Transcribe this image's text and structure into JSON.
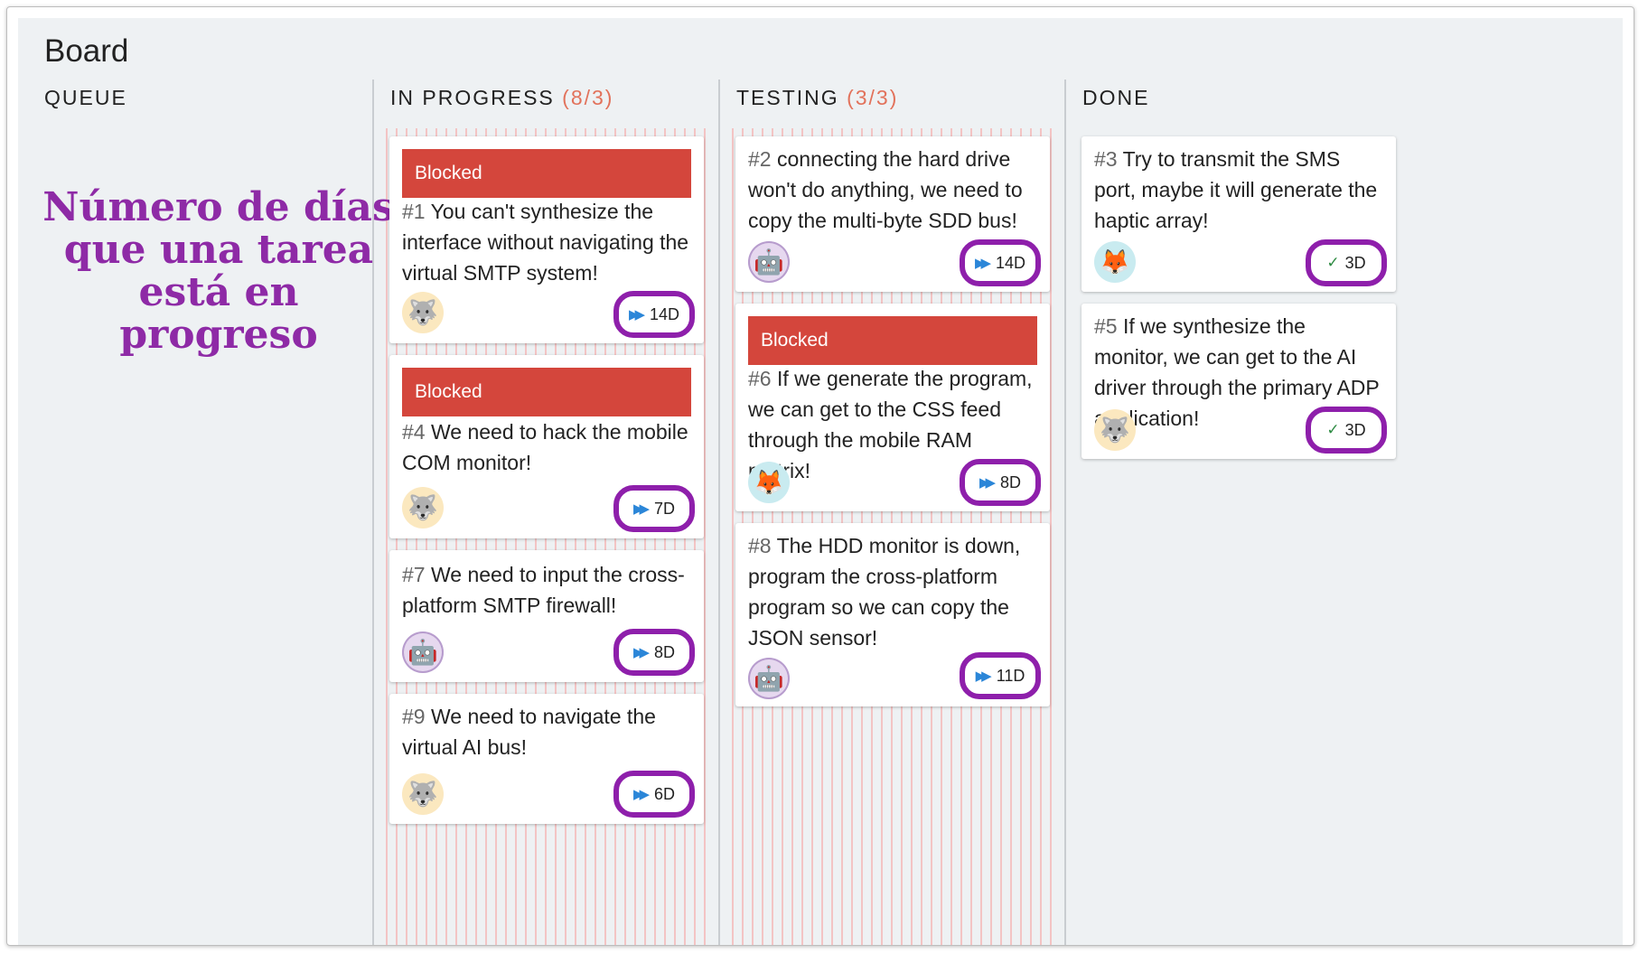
{
  "board": {
    "title": "Board"
  },
  "annotation": {
    "line1": "Número de días",
    "line2": "que una tarea",
    "line3": "está en progreso"
  },
  "columns": {
    "queue": {
      "label": "QUEUE"
    },
    "in_progress": {
      "label": "IN PROGRESS",
      "count": "(8/3)"
    },
    "testing": {
      "label": "TESTING",
      "count": "(3/3)"
    },
    "done": {
      "label": "DONE"
    }
  },
  "labels": {
    "blocked": "Blocked"
  },
  "cards": {
    "c1": {
      "num": "#1",
      "text": " You can't synthesize the interface without navigating the virtual SMTP system!",
      "avatar": "wolf-icon",
      "days": "14D",
      "blocked": true
    },
    "c4": {
      "num": "#4",
      "text": " We need to hack the mobile COM monitor!",
      "avatar": "wolf-icon",
      "days": "7D",
      "blocked": true
    },
    "c7": {
      "num": "#7",
      "text": " We need to input the cross-platform SMTP firewall!",
      "avatar": "robot-icon",
      "days": "8D",
      "blocked": false
    },
    "c9": {
      "num": "#9",
      "text": " We need to navigate the virtual AI bus!",
      "avatar": "wolf-icon",
      "days": "6D",
      "blocked": false
    },
    "c2": {
      "num": "#2",
      "text": " connecting the hard drive won't do anything, we need to copy the multi-byte SDD bus!",
      "avatar": "robot-icon",
      "days": "14D",
      "blocked": false
    },
    "c6": {
      "num": "#6",
      "text": " If we generate the program, we can get to the CSS feed through the mobile RAM matrix!",
      "avatar": "fox-icon",
      "days": "8D",
      "blocked": true
    },
    "c8": {
      "num": "#8",
      "text": " The HDD monitor is down, program the cross-platform program so we can copy the JSON sensor!",
      "avatar": "robot-icon",
      "days": "11D",
      "blocked": false
    },
    "c3": {
      "num": "#3",
      "text": " Try to transmit the SMS port, maybe it will generate the haptic array!",
      "avatar": "fox-icon",
      "days": "3D",
      "blocked": false
    },
    "c5": {
      "num": "#5",
      "text": " If we synthesize the monitor, we can get to the AI driver through the primary ADP application!",
      "avatar": "wolf-icon",
      "days": "3D",
      "blocked": false
    }
  },
  "icons": {
    "wolf": "🐺",
    "robot": "🤖",
    "fox": "🦊",
    "fast_forward": "▶▶",
    "check": "✓"
  },
  "colors": {
    "blocked": "#d4463c",
    "highlight": "#8e1fab",
    "count": "#e2725b",
    "annotation": "#8e2aa6"
  }
}
